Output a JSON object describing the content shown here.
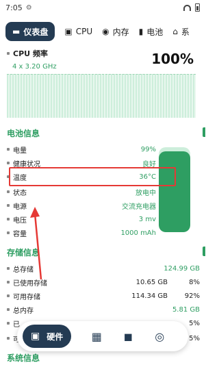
{
  "status_bar": {
    "time": "7:05"
  },
  "tabs": [
    {
      "label": "仪表盘",
      "icon": "dashboard-icon",
      "active": true
    },
    {
      "label": "CPU",
      "icon": "cpu-icon",
      "active": false
    },
    {
      "label": "内存",
      "icon": "memory-icon",
      "active": false
    },
    {
      "label": "电池",
      "icon": "battery-icon",
      "active": false
    },
    {
      "label": "系",
      "icon": "home-icon",
      "active": false
    }
  ],
  "cpu": {
    "title": "CPU 频率",
    "freq": "4 x 3.20 GHz",
    "usage": "100%"
  },
  "battery_section": {
    "title": "电池信息",
    "level_fraction": 0.95,
    "rows": [
      {
        "label": "电量",
        "value": "99%"
      },
      {
        "label": "健康状况",
        "value": "良好"
      },
      {
        "label": "温度",
        "value": "36°C"
      },
      {
        "label": "状态",
        "value": "放电中"
      },
      {
        "label": "电源",
        "value": "交流充电器"
      },
      {
        "label": "电压",
        "value": "3 mv"
      },
      {
        "label": "容量",
        "value": "1000 mAh"
      }
    ]
  },
  "storage_section": {
    "title": "存储信息",
    "rows": [
      {
        "label": "总存储",
        "value": "124.99 GB",
        "pct": ""
      },
      {
        "label": "已使用存储",
        "value": "10.65 GB",
        "pct": "8%"
      },
      {
        "label": "可用存储",
        "value": "114.34 GB",
        "pct": "92%"
      },
      {
        "label": "总内存",
        "value": "5.81 GB",
        "pct": ""
      },
      {
        "label": "已",
        "value": "",
        "pct": "5%"
      },
      {
        "label": "可",
        "value": "",
        "pct": "5%"
      }
    ]
  },
  "system_section": {
    "title": "系统信息"
  },
  "bottom_nav": {
    "active_label": "硬件",
    "items": [
      "hardware-icon",
      "apps-icon",
      "tools-icon",
      "disc-icon"
    ]
  },
  "colors": {
    "accent": "#2e9e62",
    "nav_dark": "#243b53",
    "highlight": "#e53935"
  }
}
